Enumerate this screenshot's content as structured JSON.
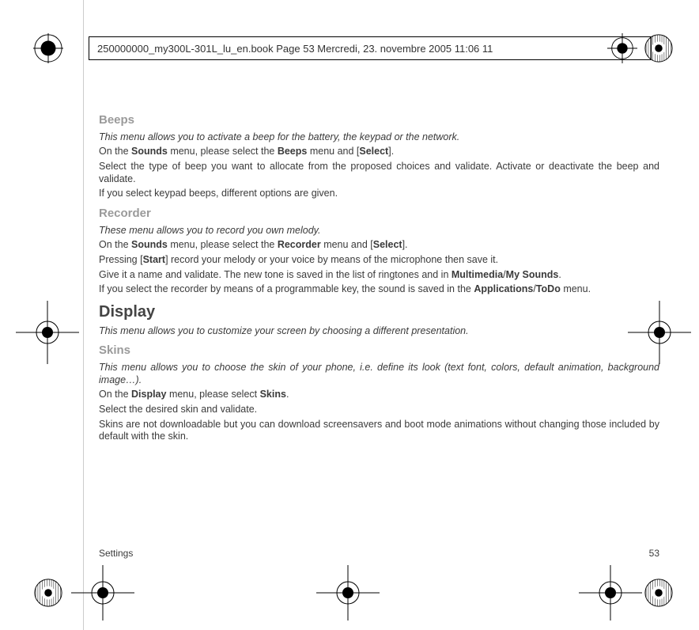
{
  "header": {
    "text": "250000000_my300L-301L_lu_en.book  Page 53  Mercredi, 23. novembre 2005  11:06 11"
  },
  "sections": {
    "beeps": {
      "title": "Beeps",
      "intro": "This menu allows you to activate a beep for the battery, the keypad or the network.",
      "p1_a": "On the ",
      "p1_b": "Sounds",
      "p1_c": " menu, please select the ",
      "p1_d": "Beeps",
      "p1_e": " menu and [",
      "p1_f": "Select",
      "p1_g": "].",
      "p2": "Select the type of beep you want to allocate from the proposed choices and validate. Activate or deactivate the beep and validate.",
      "p3": "If you select keypad beeps, different options are given."
    },
    "recorder": {
      "title": "Recorder",
      "intro": "These menu allows you to record you own melody.",
      "p1_a": "On the ",
      "p1_b": "Sounds",
      "p1_c": " menu, please select the ",
      "p1_d": "Recorder",
      "p1_e": " menu and [",
      "p1_f": "Select",
      "p1_g": "].",
      "p2_a": "Pressing [",
      "p2_b": "Start",
      "p2_c": "] record your melody or your voice by means of the microphone then save it.",
      "p3_a": "Give it a name and validate. The new tone is saved in the list of ringtones and in ",
      "p3_b": "Multimedia",
      "p3_c": "/",
      "p3_d": "My Sounds",
      "p3_e": ".",
      "p4_a": "If you select the recorder by means of a programmable key, the sound is saved in the ",
      "p4_b": "Applications",
      "p4_c": "/",
      "p4_d": "ToDo",
      "p4_e": " menu."
    },
    "display": {
      "title": "Display",
      "intro": "This menu allows you to customize your screen by choosing a different presentation."
    },
    "skins": {
      "title": "Skins",
      "intro": "This menu allows you to choose the skin of your phone, i.e. define its look (text font, colors, default animation, background image…).",
      "p1_a": "On the ",
      "p1_b": "Display",
      "p1_c": " menu, please select ",
      "p1_d": "Skins",
      "p1_e": ".",
      "p2": "Select the desired skin and validate.",
      "p3": "Skins are not downloadable but you can download screensavers and boot mode animations without changing those included by default with the skin."
    }
  },
  "footer": {
    "left": "Settings",
    "right": "53"
  }
}
